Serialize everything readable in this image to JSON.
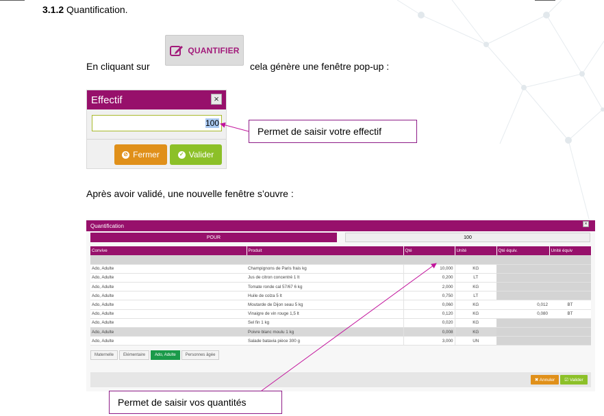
{
  "section": {
    "number": "3.1.2",
    "title": "Quantification."
  },
  "intro": {
    "before": "En cliquant sur",
    "after": "cela génère une fenêtre pop-up :"
  },
  "quantifier_button": {
    "label": "QUANTIFIER",
    "icon": "edit-icon",
    "color": "#a21a7a"
  },
  "effectif_popup": {
    "title": "Effectif",
    "close_label": "×",
    "input_value": "100",
    "fermer_label": "Fermer",
    "valider_label": "Valider",
    "header_color": "#97106b",
    "fermer_color": "#e0901a",
    "valider_color": "#8cc028"
  },
  "callout_effectif": "Permet de saisir votre effectif",
  "after_text": "Après avoir validé, une nouvelle fenêtre s’ouvre :",
  "quant_dialog": {
    "title": "Quantification",
    "close_label": "×",
    "pour_label": "POUR",
    "pour_value": "100",
    "columns": [
      "Convive",
      "Produit",
      "Qté",
      "Unité",
      "Qté équiv.",
      "Unité équiv"
    ],
    "rows": [
      {
        "convive": "Ado, Adulte",
        "produit": "Champignons de Paris frais kg",
        "qte": "10,000",
        "unite": "KG",
        "eq": "",
        "ueq": ""
      },
      {
        "convive": "Ado, Adulte",
        "produit": "Jus de citron concentré 1 lt",
        "qte": "0,200",
        "unite": "LT",
        "eq": "",
        "ueq": ""
      },
      {
        "convive": "Ado, Adulte",
        "produit": "Tomate ronde cal 57/67 6 kg",
        "qte": "2,000",
        "unite": "KG",
        "eq": "",
        "ueq": ""
      },
      {
        "convive": "Ado, Adulte",
        "produit": "Huile de colza 5 lt",
        "qte": "0,750",
        "unite": "LT",
        "eq": "",
        "ueq": ""
      },
      {
        "convive": "Ado, Adulte",
        "produit": "Moutarde de Dijon seau 5 kg",
        "qte": "0,060",
        "unite": "KG",
        "eq": "0,012",
        "ueq": "BT"
      },
      {
        "convive": "Ado, Adulte",
        "produit": "Vinaigre de vin rouge 1,5 lt",
        "qte": "0,120",
        "unite": "KG",
        "eq": "0,080",
        "ueq": "BT"
      },
      {
        "convive": "Ado, Adulte",
        "produit": "Sel fin 1 kg",
        "qte": "0,020",
        "unite": "KG",
        "eq": "",
        "ueq": ""
      },
      {
        "convive": "Ado, Adulte",
        "produit": "Poivre blanc moulu 1 kg",
        "qte": "0,008",
        "unite": "KG",
        "eq": "",
        "ueq": ""
      },
      {
        "convive": "Ado, Adulte",
        "produit": "Salade batavia pièce 300 g",
        "qte": "3,000",
        "unite": "UN",
        "eq": "",
        "ueq": ""
      }
    ],
    "age_tabs": [
      "Maternelle",
      "Elémentaire",
      "Ado, Adulte",
      "Personnes âgée"
    ],
    "active_tab": "Ado, Adulte",
    "annuler_label": "✖ Annuler",
    "valider_label": "☑ Valider"
  },
  "callout_quantites": "Permet de saisir vos quantités",
  "colors": {
    "brand": "#97106b",
    "callout_border": "#8d1a86",
    "arrow": "#c2149c"
  }
}
